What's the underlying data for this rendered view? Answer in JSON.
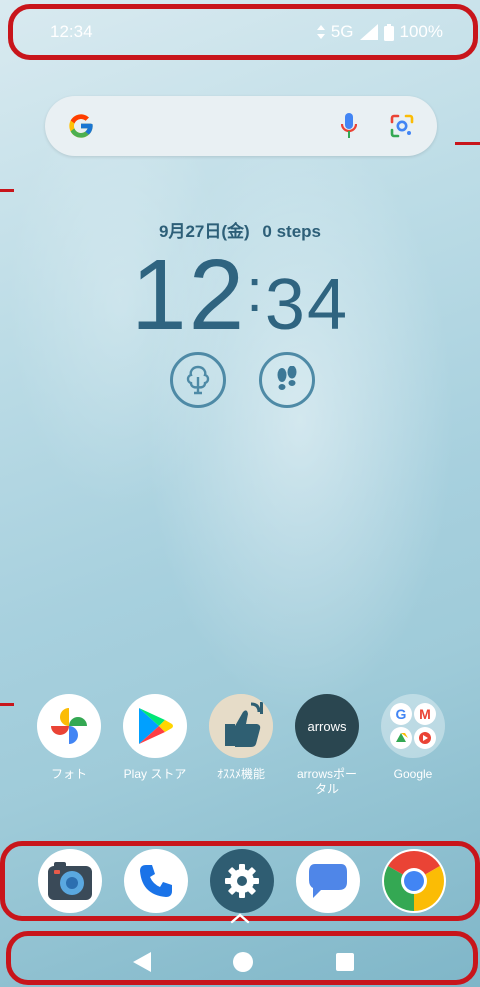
{
  "status_bar": {
    "time": "12:34",
    "network": "5G",
    "battery": "100%"
  },
  "search": {
    "mic": "mic-icon",
    "lens": "lens-icon"
  },
  "clock_widget": {
    "date": "9月27日(金)",
    "steps": "0 steps",
    "hours": "12",
    "minutes": "34"
  },
  "apps": [
    {
      "label": "フォト"
    },
    {
      "label": "Play ストア"
    },
    {
      "label": "ｵｽｽﾒ機能"
    },
    {
      "label": "arrowsポータル",
      "icon_text": "arrows"
    },
    {
      "label": "Google"
    }
  ],
  "dock": [
    "camera-icon",
    "phone-icon",
    "settings-icon",
    "messages-icon",
    "chrome-icon"
  ],
  "nav": [
    "back-button",
    "home-button",
    "recents-button"
  ],
  "colors": {
    "annotation": "#c8151b",
    "clock": "#2f6480",
    "widget_ring": "#4e8aa6"
  }
}
